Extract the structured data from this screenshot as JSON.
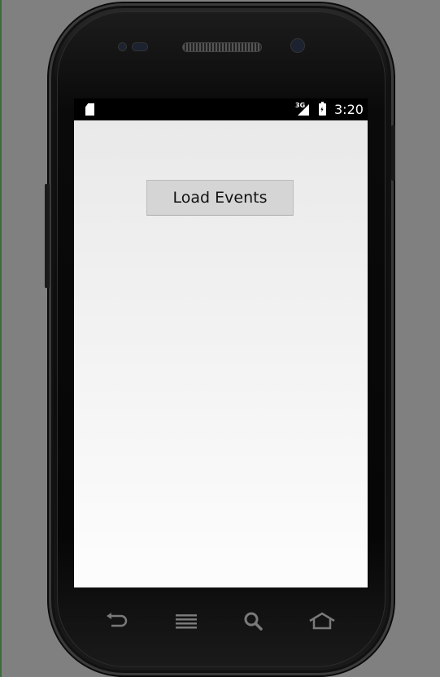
{
  "status_bar": {
    "network_label": "3G",
    "time": "3:20"
  },
  "app": {
    "load_button_label": "Load Events"
  },
  "hardware_keys": {
    "icons": [
      "back-icon",
      "menu-icon",
      "search-icon",
      "home-icon"
    ]
  },
  "colors": {
    "background": "#808080",
    "phone_body": "#111111",
    "screen_top": "#e9e9e9",
    "button": "#d5d5d5"
  }
}
